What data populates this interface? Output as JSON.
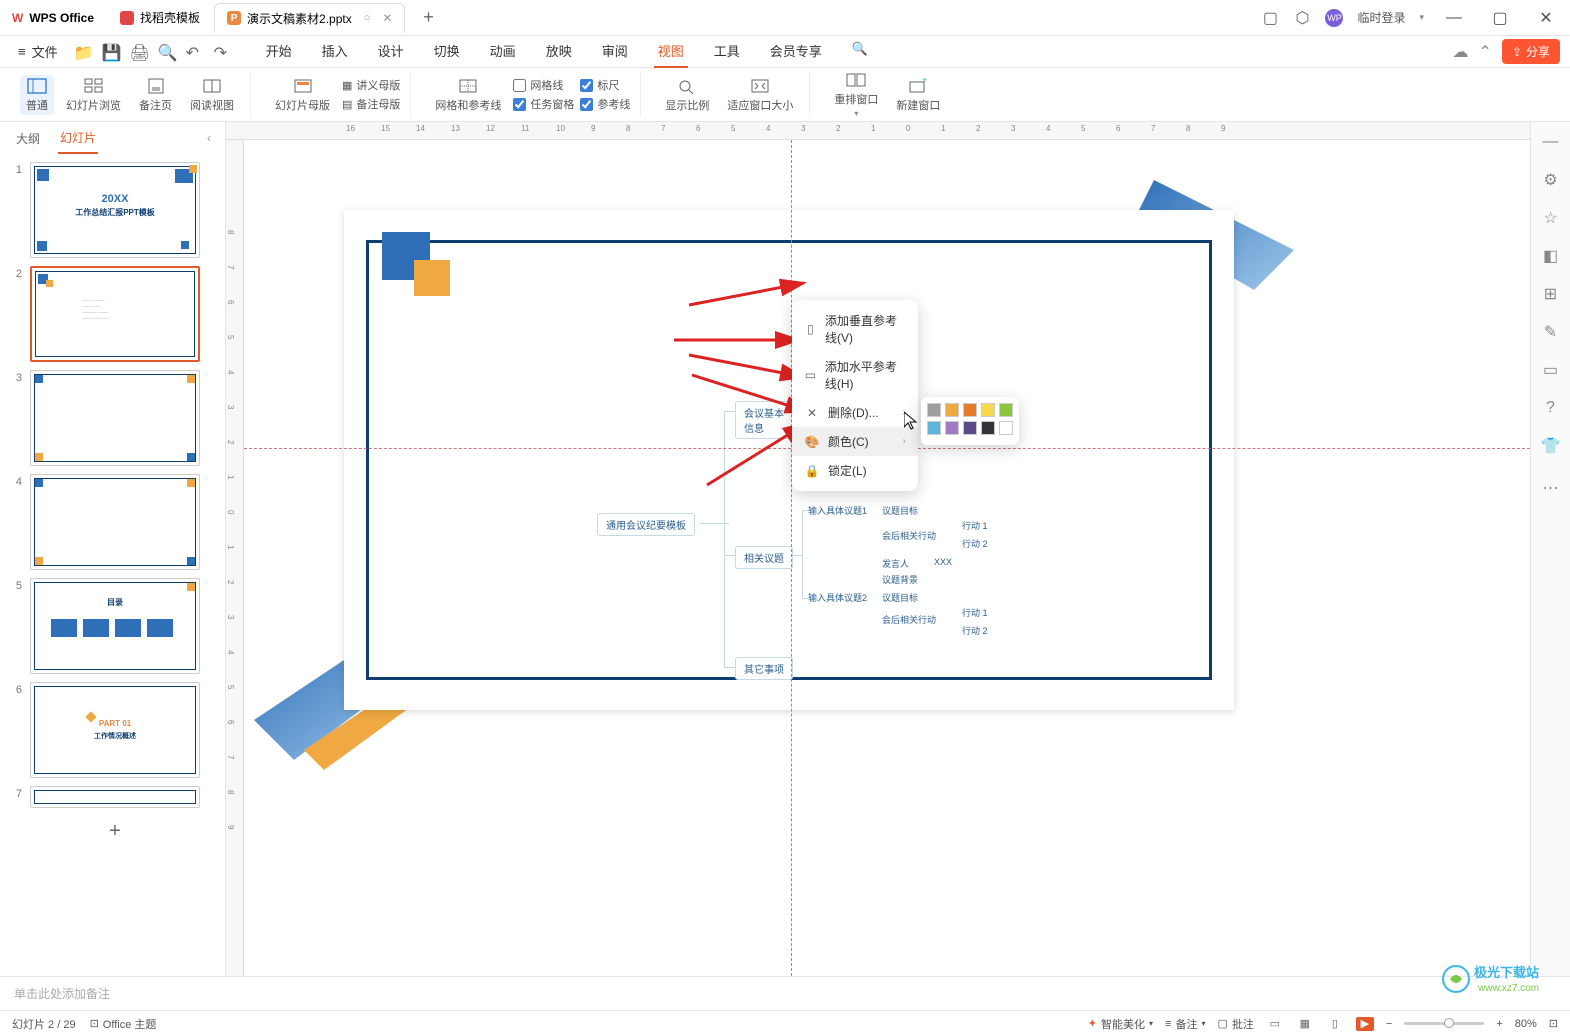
{
  "titlebar": {
    "app_name": "WPS Office",
    "tab1": "找稻壳模板",
    "tab2": "演示文稿素材2.pptx",
    "plus": "+",
    "login": "临时登录"
  },
  "menubar": {
    "file": "文件",
    "tabs": [
      "开始",
      "插入",
      "设计",
      "切换",
      "动画",
      "放映",
      "审阅",
      "视图",
      "工具",
      "会员专享"
    ],
    "active_tab": "视图",
    "share": "分享"
  },
  "ribbon": {
    "normal": "普通",
    "browse": "幻灯片浏览",
    "notes": "备注页",
    "reading": "阅读视图",
    "slide_master": "幻灯片母版",
    "handout": "讲义母版",
    "notes_master": "备注母版",
    "grid_guide": "网格和参考线",
    "chk_grid": "网格线",
    "chk_taskpane": "任务窗格",
    "chk_ruler": "标尺",
    "chk_guide": "参考线",
    "zoom_ratio": "显示比例",
    "fit_window": "适应窗口大小",
    "arrange": "重排窗口",
    "new_window": "新建窗口"
  },
  "leftpanel": {
    "outline_tab": "大纲",
    "slides_tab": "幻灯片",
    "thumbs": {
      "1": {
        "title": "20XX",
        "subtitle": "工作总结汇报PPT模板"
      },
      "5": {
        "title": "目录"
      },
      "6": {
        "title": "PART 01",
        "subtitle": "工作情况概述"
      }
    }
  },
  "context_menu": {
    "add_vertical": "添加垂直参考线(V)",
    "add_horizontal": "添加水平参考线(H)",
    "delete": "删除(D)...",
    "color": "颜色(C)",
    "lock": "锁定(L)"
  },
  "color_palette": {
    "row1": [
      "#9e9e9e",
      "#f0a942",
      "#e67a2e",
      "#f5d84f",
      "#8cc63f"
    ],
    "row2": [
      "#5fb5d9",
      "#a27bc7",
      "#5a4a8a",
      "#333333",
      "#ffffff"
    ]
  },
  "slide_content": {
    "main_box": "通用会议纪要模板",
    "basic_info": "会议基本信息",
    "related": "相关议题",
    "other": "其它事项",
    "topic1": "输入具体议题1",
    "topic2": "输入具体议题2",
    "target": "议题目标",
    "action_after": "会后相关行动",
    "speaker": "发言人",
    "bg": "议题背景",
    "xxx": "XXX",
    "action1": "行动 1",
    "action2": "行动 2"
  },
  "notes": {
    "placeholder": "单击此处添加备注"
  },
  "statusbar": {
    "slide_pos": "幻灯片 2 / 29",
    "theme": "Office 主题",
    "beautify": "智能美化",
    "notes_btn": "备注",
    "comments_btn": "批注",
    "zoom": "80%"
  },
  "watermark": {
    "line1": "极光下载站",
    "line2": "www.xz7.com"
  }
}
